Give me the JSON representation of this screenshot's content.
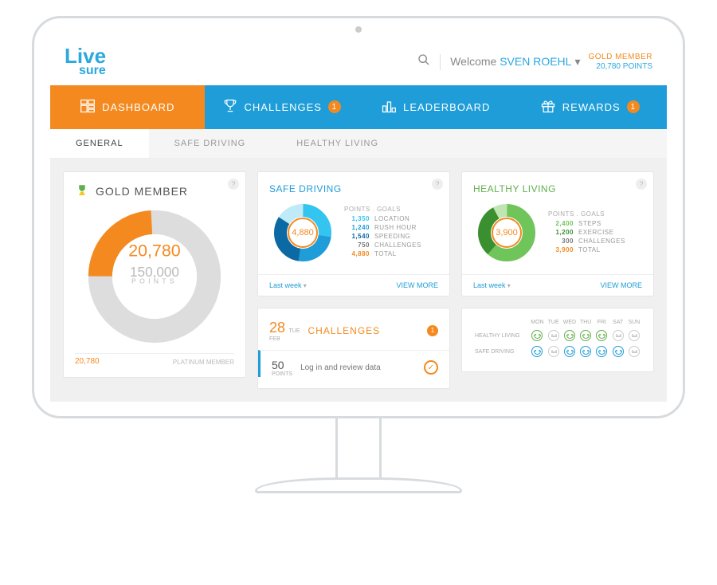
{
  "brand": {
    "line1": "Live",
    "line2": "sure"
  },
  "header": {
    "welcome_prefix": "Welcome ",
    "user_name": "SVEN ROEHL",
    "tier": "GOLD MEMBER",
    "points_text": "20,780 POINTS"
  },
  "nav": {
    "dashboard": "DASHBOARD",
    "challenges": "CHALLENGES",
    "challenges_badge": "1",
    "leaderboard": "LEADERBOARD",
    "rewards": "REWARDS",
    "rewards_badge": "1"
  },
  "subnav": {
    "general": "GENERAL",
    "safe": "SAFE DRIVING",
    "healthy": "HEALTHY LIVING"
  },
  "member": {
    "title": "GOLD MEMBER",
    "points": "20,780",
    "target": "150,000",
    "points_label": "POINTS",
    "current_short": "20,780",
    "next_tier": "PLATINUM MEMBER",
    "progress_pct": 24
  },
  "safe_driving": {
    "title": "SAFE DRIVING",
    "legend_head": "POINTS . GOALS",
    "center": "4,880",
    "rows": [
      {
        "v": "1,350",
        "l": "LOCATION",
        "c": "#34c4f0"
      },
      {
        "v": "1,240",
        "l": "RUSH HOUR",
        "c": "#1e9dd8"
      },
      {
        "v": "1,540",
        "l": "SPEEDING",
        "c": "#0b6aa3"
      },
      {
        "v": "750",
        "l": "CHALLENGES",
        "c": "#bfeaf7"
      },
      {
        "v": "4,880",
        "l": "TOTAL",
        "c": "#f48a1f"
      }
    ],
    "footer_left": "Last week",
    "footer_right": "VIEW MORE"
  },
  "healthy_living": {
    "title": "HEALTHY LIVING",
    "legend_head": "POINTS . GOALS",
    "center": "3,900",
    "rows": [
      {
        "v": "2,400",
        "l": "STEPS",
        "c": "#6fc45a"
      },
      {
        "v": "1,200",
        "l": "EXERCISE",
        "c": "#3a8f2e"
      },
      {
        "v": "300",
        "l": "CHALLENGES",
        "c": "#bfe6b2"
      },
      {
        "v": "3,900",
        "l": "TOTAL",
        "c": "#f48a1f"
      }
    ],
    "footer_left": "Last week",
    "footer_right": "VIEW MORE"
  },
  "challenges_card": {
    "day": "28",
    "dow": "TUE",
    "month": "FEB",
    "title": "CHALLENGES",
    "badge": "1",
    "item_points": "50",
    "item_points_label": "POINTS",
    "item_desc": "Log in and review data"
  },
  "mood": {
    "days": [
      "MON",
      "TUE",
      "WED",
      "THU",
      "FRI",
      "SAT",
      "SUN"
    ],
    "row1_label": "HEALTHY LIVING",
    "row2_label": "SAFE DRIVING"
  },
  "chart_data": [
    {
      "type": "pie",
      "title": "Gold Member Progress",
      "series": [
        {
          "name": "Earned",
          "value": 20780
        },
        {
          "name": "Remaining",
          "value": 129220
        }
      ],
      "total_target": 150000
    },
    {
      "type": "pie",
      "title": "Safe Driving Points",
      "series": [
        {
          "name": "Location",
          "value": 1350
        },
        {
          "name": "Rush Hour",
          "value": 1240
        },
        {
          "name": "Speeding",
          "value": 1540
        },
        {
          "name": "Challenges",
          "value": 750
        }
      ],
      "total": 4880
    },
    {
      "type": "pie",
      "title": "Healthy Living Points",
      "series": [
        {
          "name": "Steps",
          "value": 2400
        },
        {
          "name": "Exercise",
          "value": 1200
        },
        {
          "name": "Challenges",
          "value": 300
        }
      ],
      "total": 3900
    }
  ]
}
